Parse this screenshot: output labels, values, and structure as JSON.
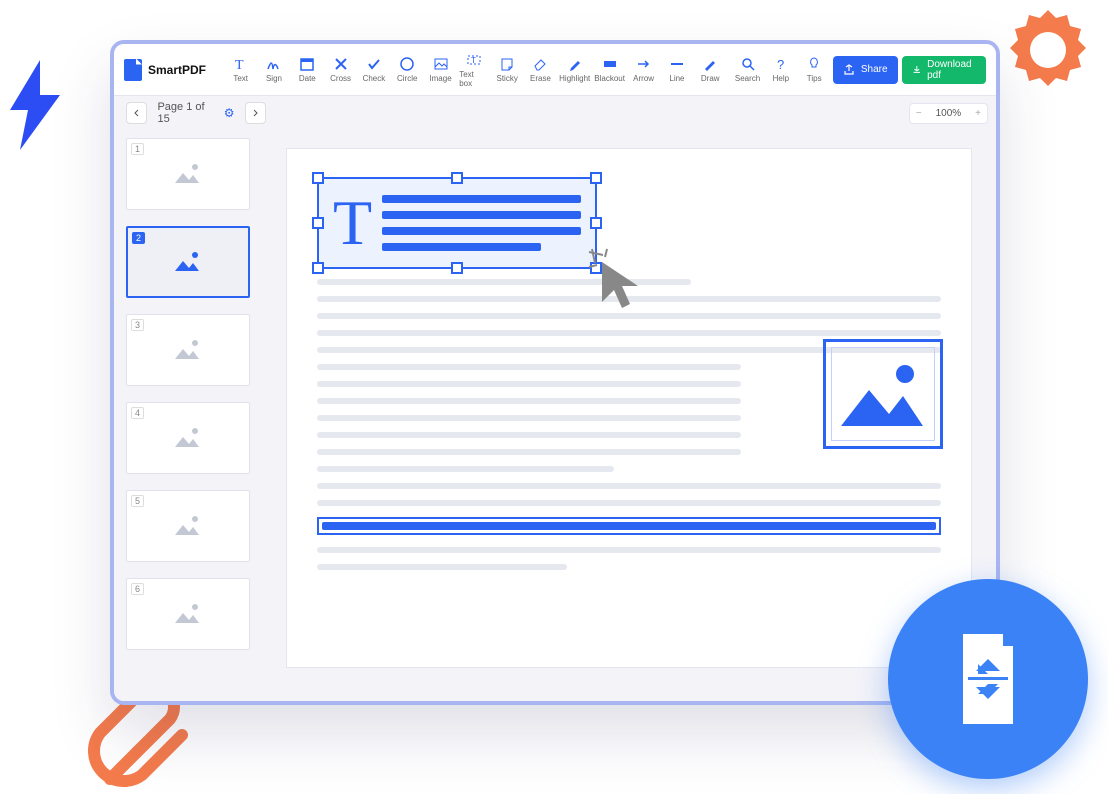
{
  "brand": "SmartPDF",
  "tools": [
    {
      "label": "Text"
    },
    {
      "label": "Sign"
    },
    {
      "label": "Date"
    },
    {
      "label": "Cross"
    },
    {
      "label": "Check"
    },
    {
      "label": "Circle"
    },
    {
      "label": "Image"
    },
    {
      "label": "Text box"
    },
    {
      "label": "Sticky"
    },
    {
      "label": "Erase"
    },
    {
      "label": "Highlight"
    },
    {
      "label": "Blackout"
    },
    {
      "label": "Arrow"
    },
    {
      "label": "Line"
    },
    {
      "label": "Draw"
    }
  ],
  "right_tools": [
    {
      "label": "Search"
    },
    {
      "label": "Help"
    },
    {
      "label": "Tips"
    }
  ],
  "buttons": {
    "share": "Share",
    "download": "Download pdf"
  },
  "page_nav": {
    "label": "Page 1 of 15"
  },
  "zoom": {
    "value": "100%"
  },
  "thumbs": [
    {
      "num": "1"
    },
    {
      "num": "2"
    },
    {
      "num": "3"
    },
    {
      "num": "4"
    },
    {
      "num": "5"
    },
    {
      "num": "6"
    }
  ],
  "active_thumb": 1
}
